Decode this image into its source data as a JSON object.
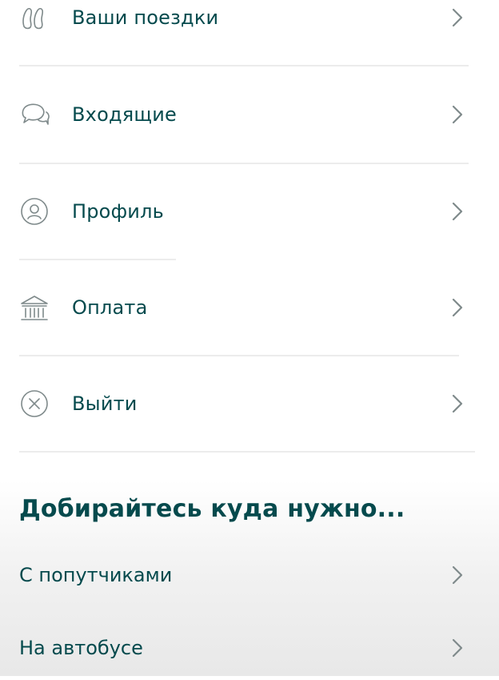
{
  "menu": {
    "items": [
      {
        "label": "Ваши поездки",
        "icon": "rides-icon"
      },
      {
        "label": "Входящие",
        "icon": "chat-bubbles-icon"
      },
      {
        "label": "Профиль",
        "icon": "profile-icon"
      },
      {
        "label": "Оплата",
        "icon": "bank-icon"
      },
      {
        "label": "Выйти",
        "icon": "logout-x-icon"
      }
    ]
  },
  "travel": {
    "title": "Добирайтесь куда нужно...",
    "options": [
      {
        "label": "С попутчиками"
      },
      {
        "label": "На автобусе"
      }
    ]
  },
  "colors": {
    "text": "#054a4d",
    "icon": "#7f8a8b",
    "chevron": "#7f8a8b",
    "divider": "#ececec"
  }
}
